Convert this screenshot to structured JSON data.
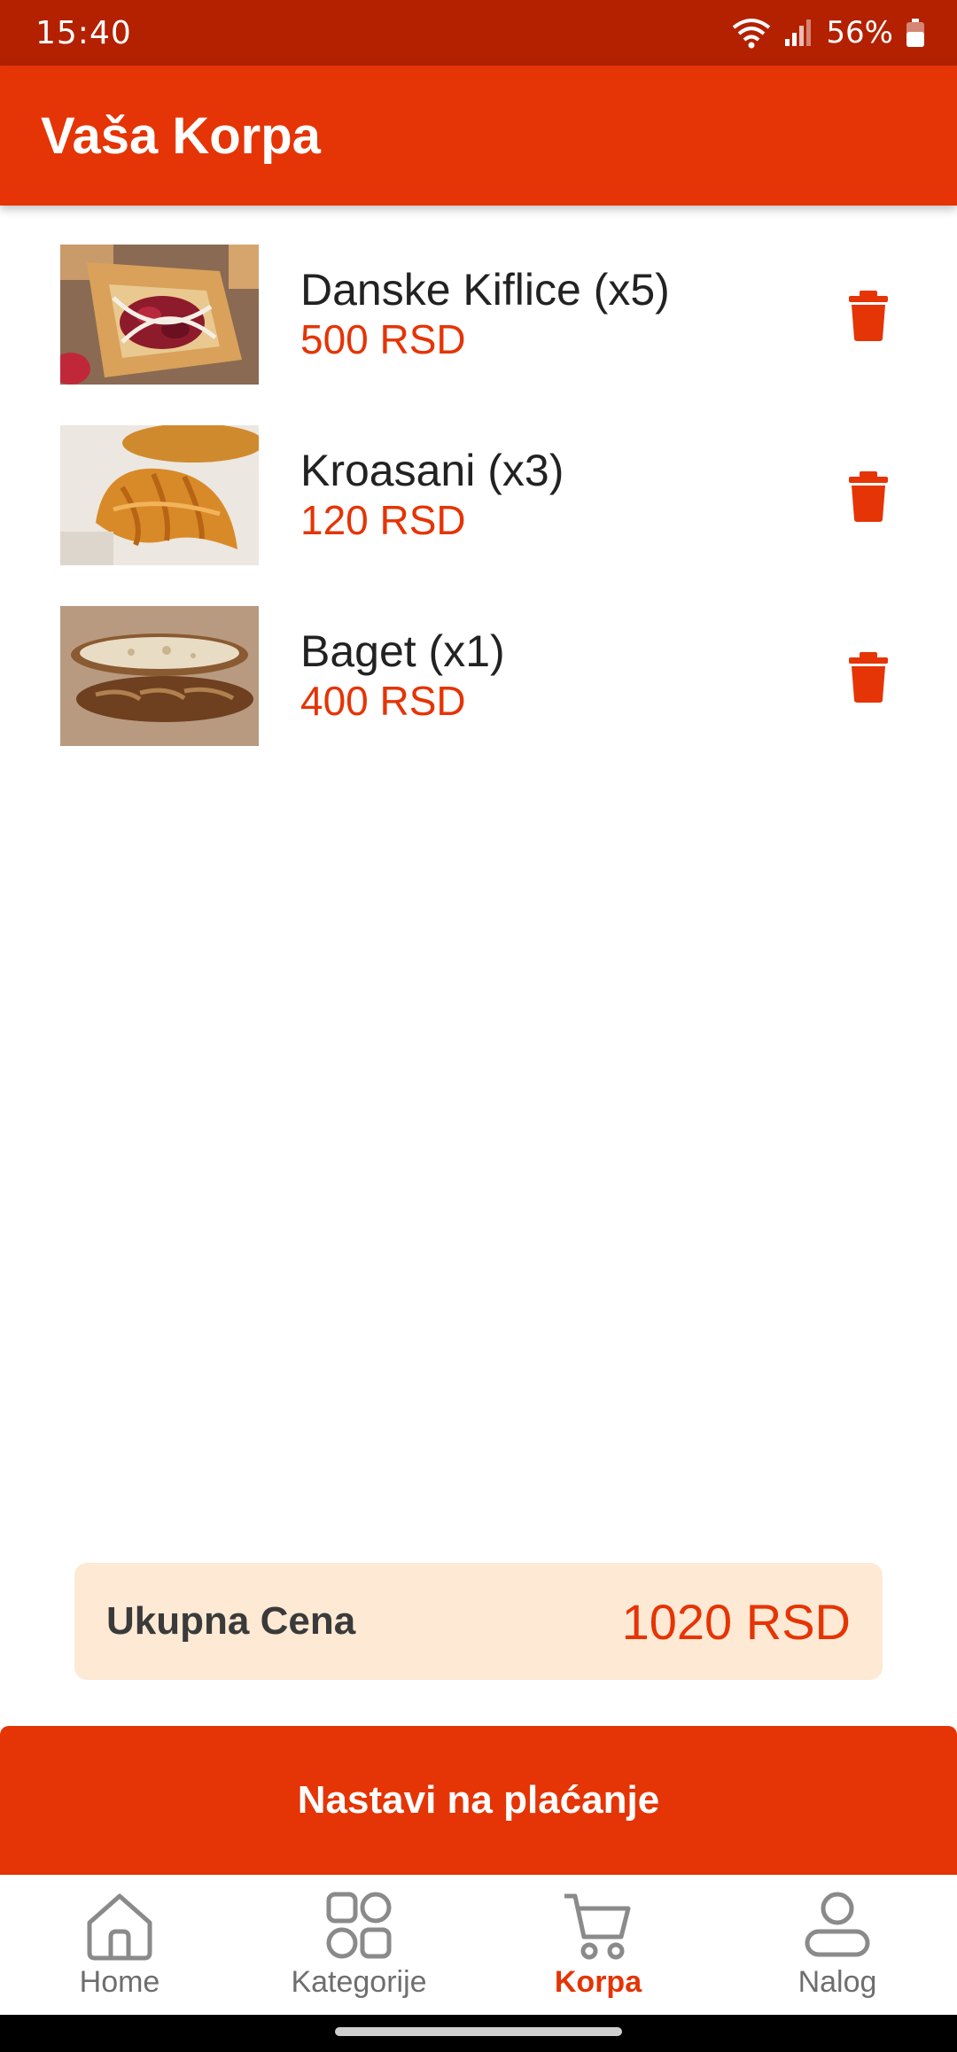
{
  "status_bar": {
    "time": "15:40",
    "battery": "56%"
  },
  "header": {
    "title": "Vaša Korpa"
  },
  "cart": {
    "items": [
      {
        "name": "Danske Kiflice (x5)",
        "price": "500 RSD",
        "image": "danish-pastry-photo"
      },
      {
        "name": "Kroasani (x3)",
        "price": "120 RSD",
        "image": "croissant-photo"
      },
      {
        "name": "Baget (x1)",
        "price": "400 RSD",
        "image": "baguette-photo"
      }
    ]
  },
  "summary": {
    "total_label": "Ukupna Cena",
    "total_value": "1020 RSD"
  },
  "checkout": {
    "label": "Nastavi na plaćanje"
  },
  "bottom_nav": {
    "items": [
      {
        "label": "Home",
        "icon": "home-icon",
        "active": false
      },
      {
        "label": "Kategorije",
        "icon": "grid-icon",
        "active": false
      },
      {
        "label": "Korpa",
        "icon": "cart-icon",
        "active": true
      },
      {
        "label": "Nalog",
        "icon": "user-icon",
        "active": false
      }
    ]
  },
  "colors": {
    "accent": "#e53405",
    "status_bar": "#b32100",
    "summary_bg": "#fde9d4"
  }
}
